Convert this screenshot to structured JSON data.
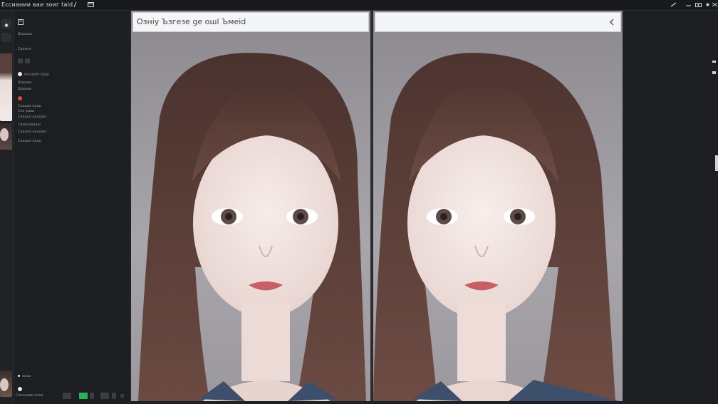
{
  "app": {
    "title": "Ессиании ваи зоиг taid"
  },
  "topbar": {
    "menu_icon": "slash-icon",
    "window_icon": "window-icon",
    "right_icons": [
      "pen-icon",
      "minimize-icon",
      "camera-icon",
      "dot-icon",
      "close-icon"
    ]
  },
  "left_panel": {
    "heading": "Ш",
    "lines": [
      "Шашшо",
      "Свонга",
      "кашшов ашш",
      "Шашои",
      "Сашшо ашш",
      "Ссо ашш",
      "Сашшо ашшшо",
      "Свсошашшо",
      "Сашшо ашшшо"
    ]
  },
  "left_view": {
    "search": {
      "value": "Озніу Ъзгезе ge ошl Ъмеіd"
    }
  },
  "right_view": {
    "search": {
      "value": ""
    }
  },
  "bottom": {
    "lines": [
      "ашш",
      "Саашшво ашш"
    ]
  },
  "colors": {
    "accent": "#2fae5a",
    "danger": "#d84a4a",
    "bg": "#1e2024"
  }
}
